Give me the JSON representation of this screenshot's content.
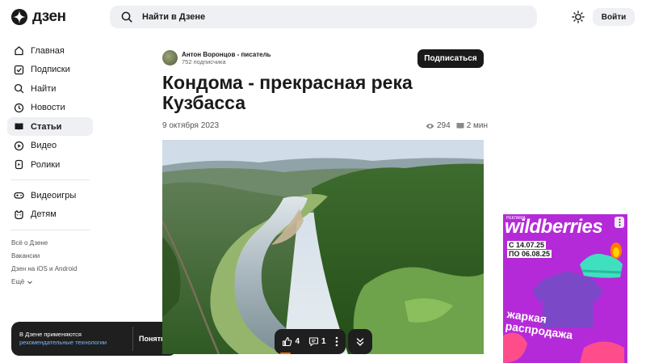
{
  "header": {
    "logo_text": "дзен",
    "search_placeholder": "Найти в Дзене",
    "login_label": "Войти"
  },
  "nav": {
    "items": [
      {
        "label": "Главная",
        "icon": "home-icon"
      },
      {
        "label": "Подписки",
        "icon": "subscriptions-icon"
      },
      {
        "label": "Найти",
        "icon": "search-icon"
      },
      {
        "label": "Новости",
        "icon": "news-icon"
      },
      {
        "label": "Статьи",
        "icon": "articles-icon",
        "active": true
      },
      {
        "label": "Видео",
        "icon": "video-icon"
      },
      {
        "label": "Ролики",
        "icon": "clips-icon"
      },
      {
        "label": "Видеоигры",
        "icon": "gamepad-icon"
      },
      {
        "label": "Детям",
        "icon": "kids-icon"
      }
    ]
  },
  "footer_links": [
    "Всё о Дзене",
    "Вакансии",
    "Дзен на iOS и Android",
    "Ещё"
  ],
  "cookie": {
    "text": "В Дзене применяются",
    "link": "рекомендательные технологии",
    "button": "Понятно"
  },
  "article": {
    "author_name": "Антон Воронцов - писатель",
    "author_subs": "752 подписчика",
    "subscribe_label": "Подписаться",
    "title": "Кондома - прекрасная река Кузбасса",
    "date": "9 октября 2023",
    "views": "294",
    "read_time": "2 мин"
  },
  "actions": {
    "likes": "4",
    "comments": "1"
  },
  "ad": {
    "label": "РЕКЛАМА",
    "brand": "wildberries",
    "date_from": "С 14.07.25",
    "date_to": "ПО 06.08.25",
    "slogan_line1": "жаркая",
    "slogan_line2": "распродажа"
  }
}
